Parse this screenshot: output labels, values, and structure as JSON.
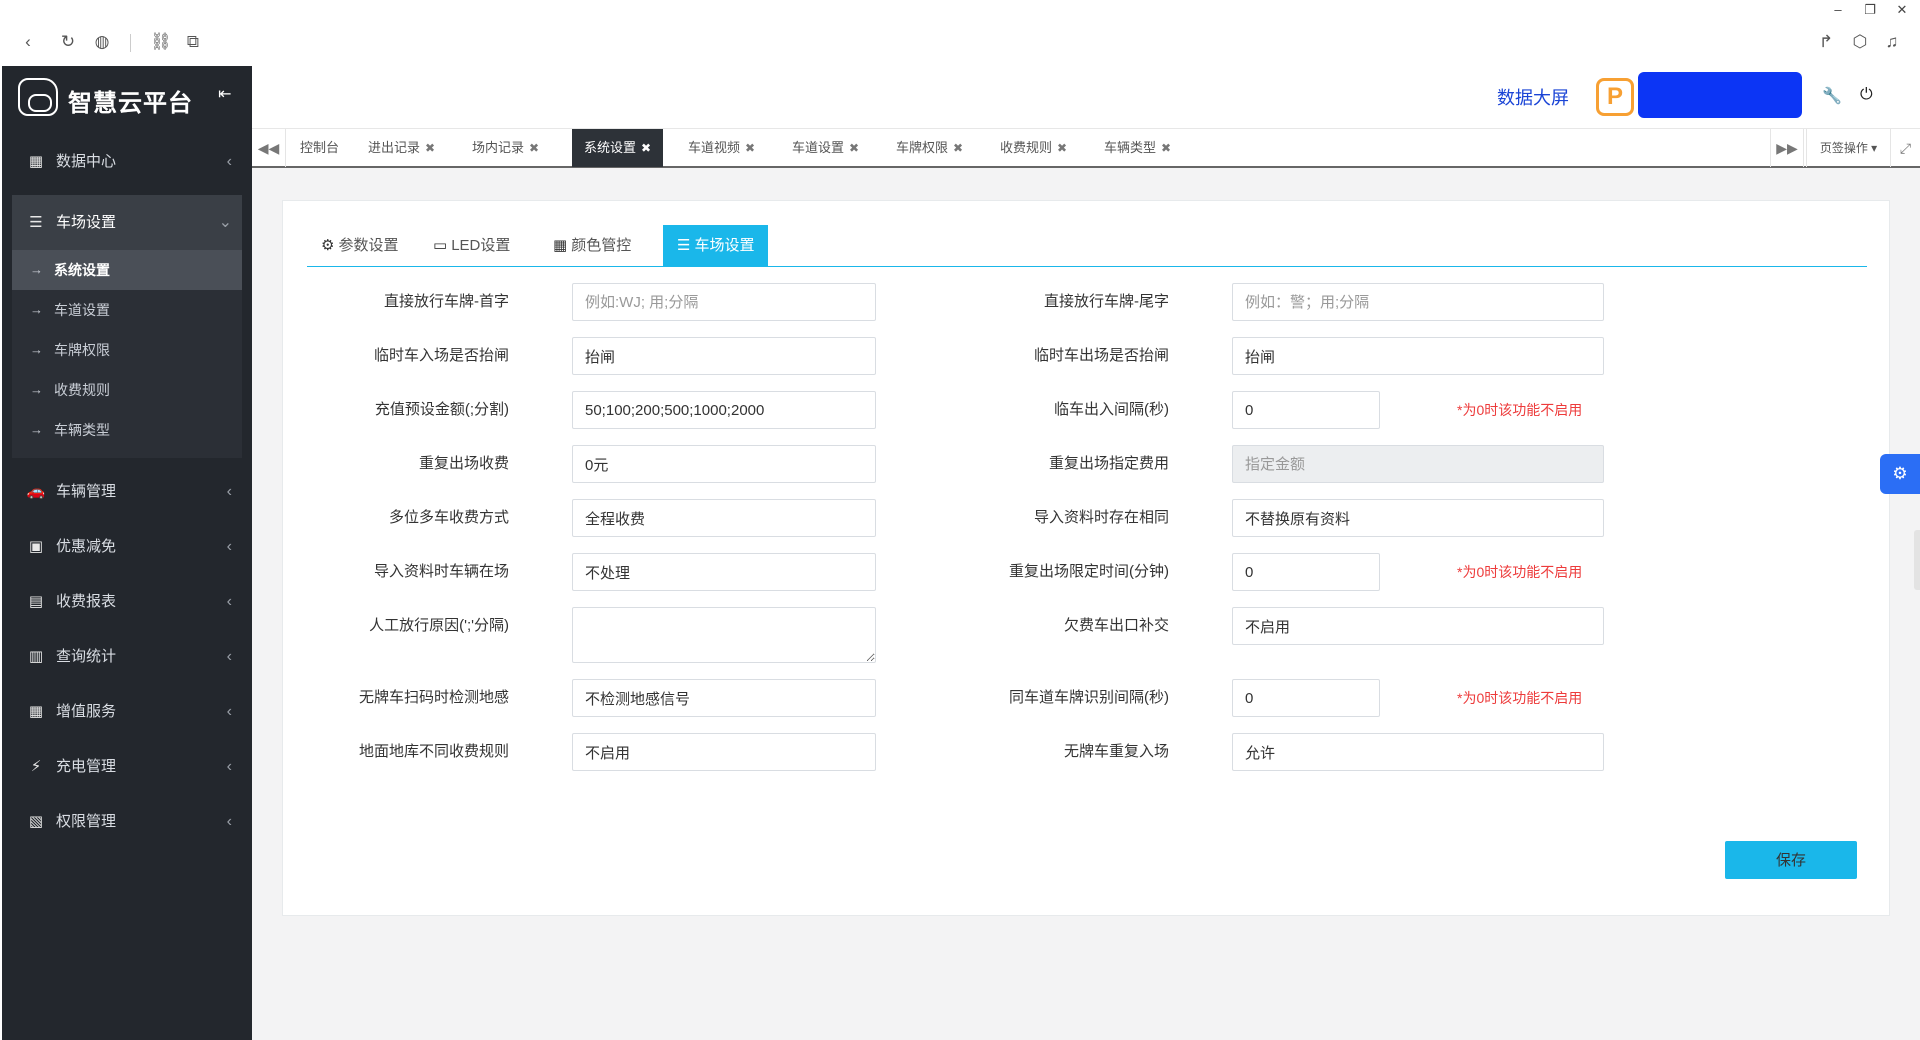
{
  "browser": {
    "back_icon": "‹",
    "refresh_icon": "↻",
    "globe_icon": "◍",
    "link_icon": "⛓",
    "ext_icon": "⧉",
    "share_icon": "↱",
    "cube_icon": "⬡",
    "sound_icon": "♫",
    "min_icon": "–",
    "restore_icon": "❐",
    "close_icon": "✕"
  },
  "sidebar": {
    "brand_title": "智慧云平台",
    "collapse_icon": "⇤",
    "items": [
      {
        "label": "数据中心",
        "icon": "▦",
        "arrow": "‹"
      },
      {
        "label": "车场设置",
        "icon": "☰",
        "arrow": "⌄"
      },
      {
        "label": "车辆管理",
        "icon": "🚗",
        "arrow": "‹"
      },
      {
        "label": "优惠减免",
        "icon": "▣",
        "arrow": "‹"
      },
      {
        "label": "收费报表",
        "icon": "▤",
        "arrow": "‹"
      },
      {
        "label": "查询统计",
        "icon": "▥",
        "arrow": "‹"
      },
      {
        "label": "增值服务",
        "icon": "▦",
        "arrow": "‹"
      },
      {
        "label": "充电管理",
        "icon": "⚡",
        "arrow": "‹"
      },
      {
        "label": "权限管理",
        "icon": "▧",
        "arrow": "‹"
      }
    ],
    "sub_items": [
      {
        "label": "系统设置",
        "arrow": "→"
      },
      {
        "label": "车道设置",
        "arrow": "→"
      },
      {
        "label": "车牌权限",
        "arrow": "→"
      },
      {
        "label": "收费规则",
        "arrow": "→"
      },
      {
        "label": "车辆类型",
        "arrow": "→"
      }
    ]
  },
  "header": {
    "data_screen": "数据大屏",
    "p_logo": "P",
    "wrench_icon": "🔧",
    "logout_icon": "⏻"
  },
  "tabs": {
    "prev_icon": "◀◀",
    "next_icon": "▶▶",
    "close_mark": "✖",
    "items": [
      "控制台",
      "进出记录",
      "场内记录",
      "系统设置",
      "车道视频",
      "车道设置",
      "车牌权限",
      "收费规则",
      "车辆类型"
    ],
    "page_ops": "页签操作 ▾",
    "fullscreen_icon": "⤢"
  },
  "inner_tabs": [
    {
      "label": "参数设置",
      "icon": "⚙"
    },
    {
      "label": "LED设置",
      "icon": "▭"
    },
    {
      "label": "颜色管控",
      "icon": "▦"
    },
    {
      "label": "车场设置",
      "icon": "☰"
    }
  ],
  "form": {
    "left": [
      {
        "label": "直接放行车牌-首字",
        "value": "",
        "placeholder": "例如:WJ; 用;分隔"
      },
      {
        "label": "临时车入场是否抬闸",
        "value": "抬闸",
        "placeholder": ""
      },
      {
        "label": "充值预设金额(;分割)",
        "value": "50;100;200;500;1000;2000",
        "placeholder": ""
      },
      {
        "label": "重复出场收费",
        "value": "0元",
        "placeholder": ""
      },
      {
        "label": "多位多车收费方式",
        "value": "全程收费",
        "placeholder": ""
      },
      {
        "label": "导入资料时车辆在场",
        "value": "不处理",
        "placeholder": ""
      },
      {
        "label": "人工放行原因(';'分隔)",
        "value": "",
        "placeholder": ""
      },
      {
        "label": "无牌车扫码时检测地感",
        "value": "不检测地感信号",
        "placeholder": ""
      },
      {
        "label": "地面地库不同收费规则",
        "value": "不启用",
        "placeholder": ""
      }
    ],
    "right": [
      {
        "label": "直接放行车牌-尾字",
        "value": "",
        "placeholder": "例如：警；用;分隔"
      },
      {
        "label": "临时车出场是否抬闸",
        "value": "抬闸",
        "placeholder": ""
      },
      {
        "label": "临车出入间隔(秒)",
        "value": "0",
        "placeholder": "",
        "note": "*为0时该功能不启用"
      },
      {
        "label": "重复出场指定费用",
        "value": "",
        "placeholder": "指定金额",
        "disabled": true
      },
      {
        "label": "导入资料时存在相同",
        "value": "不替换原有资料",
        "placeholder": ""
      },
      {
        "label": "重复出场限定时间(分钟)",
        "value": "0",
        "placeholder": "",
        "note": "*为0时该功能不启用"
      },
      {
        "label": "欠费车出口补交",
        "value": "不启用",
        "placeholder": ""
      },
      {
        "label": "同车道车牌识别间隔(秒)",
        "value": "0",
        "placeholder": "",
        "note": "*为0时该功能不启用"
      },
      {
        "label": "无牌车重复入场",
        "value": "允许",
        "placeholder": ""
      }
    ],
    "save_label": "保存"
  },
  "floating": {
    "gear_icon": "⚙"
  }
}
